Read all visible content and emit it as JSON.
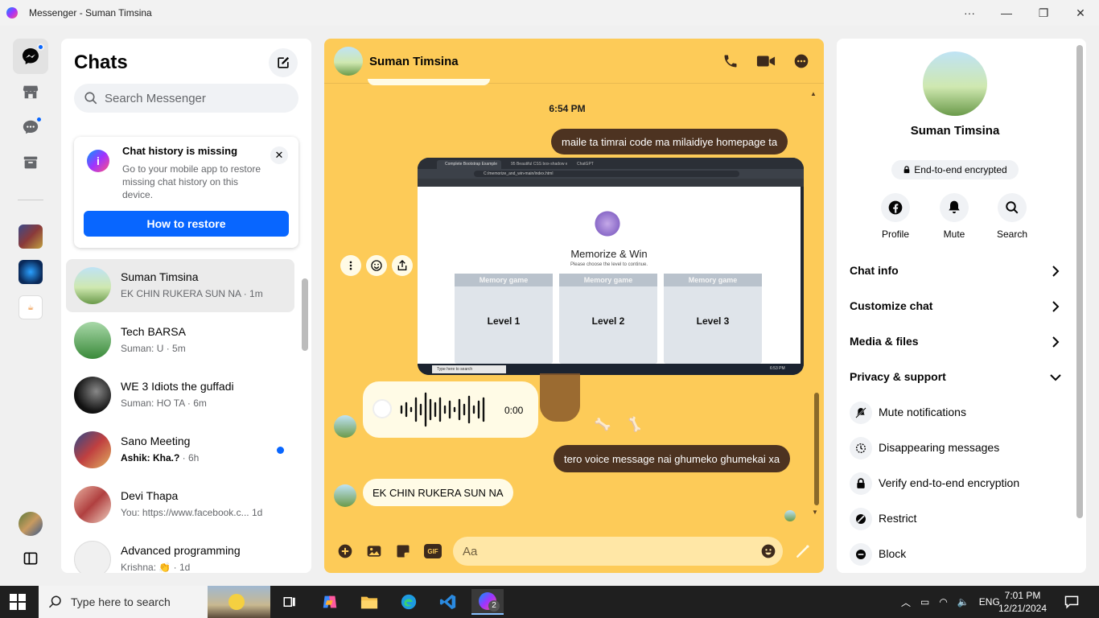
{
  "window": {
    "title": "Messenger - Suman Timsina",
    "more_label": "···",
    "minimize_label": "—",
    "restore_label": "❐",
    "close_label": "✕"
  },
  "chats": {
    "title": "Chats",
    "search_placeholder": "Search Messenger",
    "notice": {
      "title": "Chat history is missing",
      "body": "Go to your mobile app to restore missing chat history on this device.",
      "button": "How to restore",
      "close": "✕"
    },
    "items": [
      {
        "name": "Suman Timsina",
        "preview": "EK CHIN RUKERA SUN NA · 1m",
        "selected": true,
        "unread": false
      },
      {
        "name": "Tech BARSA",
        "preview": "Suman: U · 5m",
        "selected": false,
        "unread": false
      },
      {
        "name": "WE 3 Idiots the guffadi",
        "preview": "Suman: HO TA · 6m",
        "selected": false,
        "unread": false
      },
      {
        "name": "Sano Meeting",
        "preview_bold": "Ashik: Kha.?",
        "preview_tail": " · 6h",
        "selected": false,
        "unread": true
      },
      {
        "name": "Devi Thapa",
        "preview": "You: https://www.facebook.c...   1d",
        "selected": false,
        "unread": false
      },
      {
        "name": "Advanced programming",
        "preview": "Krishna: 👏 · 1d",
        "selected": false,
        "unread": false
      }
    ]
  },
  "conversation": {
    "name": "Suman Timsina",
    "time_separator": "6:54 PM",
    "messages": {
      "out1": "maile ta timrai code ma milaidiye homepage ta",
      "out2": "tero voice message nai ghumeko ghumekai xa",
      "in1": "EK CHIN RUKERA SUN NA"
    },
    "voice_duration": "0:00",
    "composer_placeholder": "Aa",
    "gif_label": "GIF",
    "screenshot": {
      "tabs": [
        "Complete Bootstrap Example",
        "95 Beautiful CSS box-shadow ex...",
        "ChatGPT"
      ],
      "address": "C:/memorize_and_win-main/index.html",
      "app_title": "Memorize & Win",
      "app_subtitle": "Please choose the level to continue.",
      "card_header": "Memory game",
      "levels": [
        "Level 1",
        "Level 2",
        "Level 3"
      ],
      "taskbar_search": "Type here to search",
      "clock": "6:53 PM"
    }
  },
  "info": {
    "name": "Suman Timsina",
    "e2e": "End-to-end encrypted",
    "actions": [
      "Profile",
      "Mute",
      "Search"
    ],
    "sections": [
      "Chat info",
      "Customize chat",
      "Media & files",
      "Privacy & support"
    ],
    "privacy_items": [
      "Mute notifications",
      "Disappearing messages",
      "Verify end-to-end encryption",
      "Restrict",
      "Block"
    ]
  },
  "taskbar": {
    "search_placeholder": "Type here to search",
    "messenger_badge": "2",
    "language": "ENG",
    "time": "7:01 PM",
    "date": "12/21/2024"
  },
  "colors": {
    "accent": "#0866ff",
    "chat_theme": "#fdcb58",
    "outgoing_bubble": "#4d3321"
  }
}
